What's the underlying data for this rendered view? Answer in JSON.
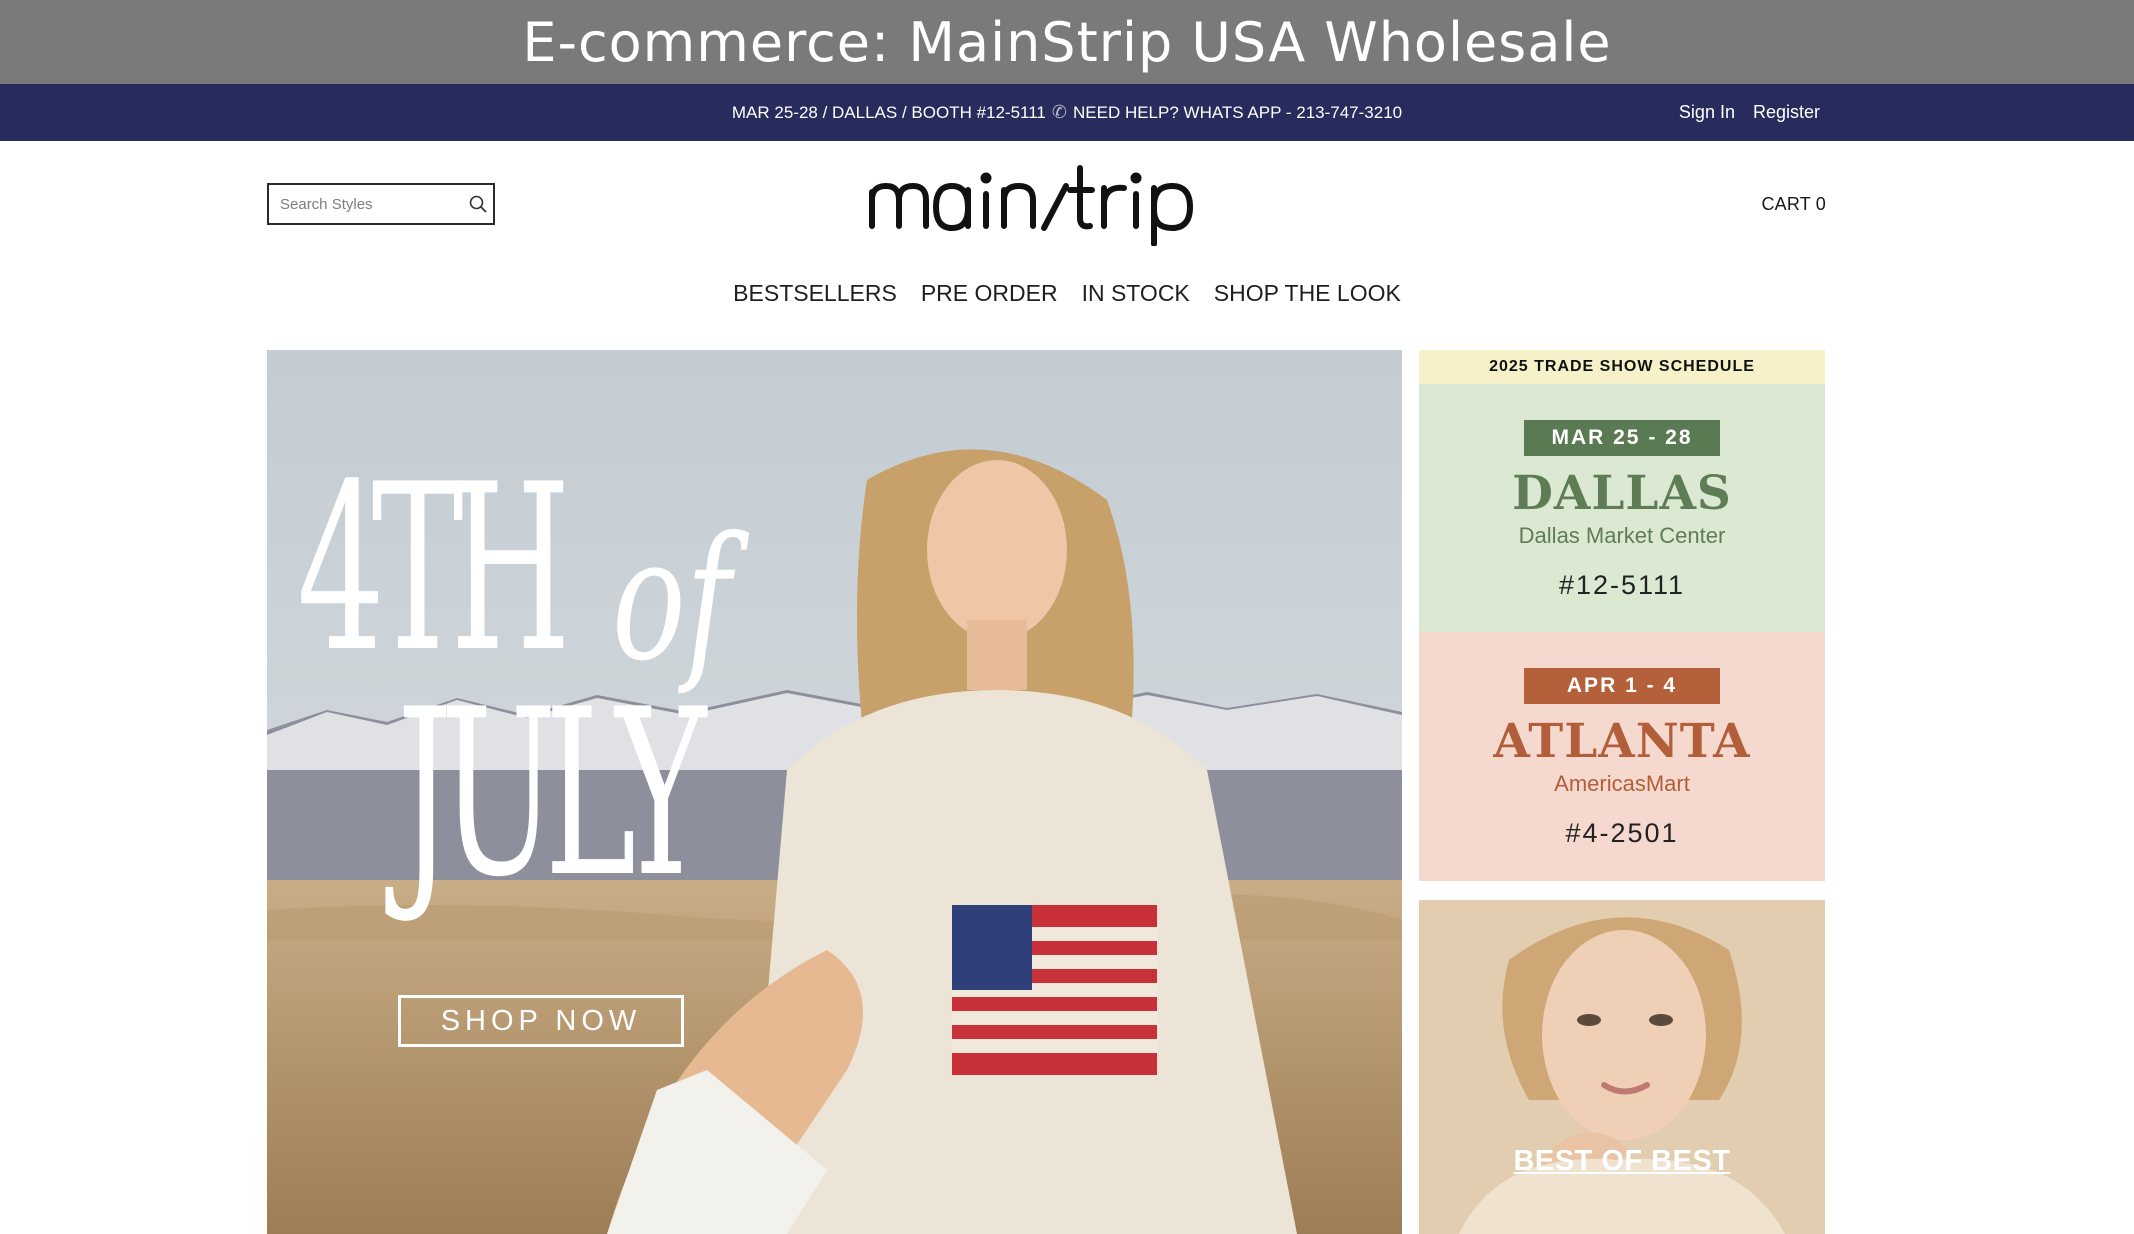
{
  "caption": "E-commerce: MainStrip USA Wholesale",
  "announcement": {
    "text_before_icon": "MAR 25-28 / DALLAS / BOOTH #12-5111",
    "text_after_icon": "NEED HELP? WHATS APP - 213-747-3210",
    "icon": "phone-icon"
  },
  "account": {
    "sign_in": "Sign In",
    "register": "Register"
  },
  "search": {
    "placeholder": "Search Styles"
  },
  "logo": {
    "text": "mainstrip"
  },
  "cart": {
    "label": "CART 0"
  },
  "nav": {
    "items": [
      "BESTSELLERS",
      "PRE ORDER",
      "IN STOCK",
      "SHOP THE LOOK"
    ]
  },
  "hero": {
    "line1": "4TH",
    "of": "of",
    "line2": "JULY",
    "cta": "SHOP NOW"
  },
  "schedule": {
    "title": "2025 TRADE SHOW SCHEDULE",
    "shows": [
      {
        "dates": "MAR 25 - 28",
        "city": "DALLAS",
        "venue": "Dallas Market Center",
        "booth": "#12-5111",
        "accent": "#5a7a53",
        "background": "#dbe9d3"
      },
      {
        "dates": "APR 1 - 4",
        "city": "ATLANTA",
        "venue": "AmericasMart",
        "booth": "#4-2501",
        "accent": "#b4603a",
        "background": "#f6d9ce"
      }
    ]
  },
  "promo": {
    "label": "BEST OF BEST"
  },
  "colors": {
    "topbar": "#272c5d",
    "caption_bg": "#7a7a7a"
  }
}
